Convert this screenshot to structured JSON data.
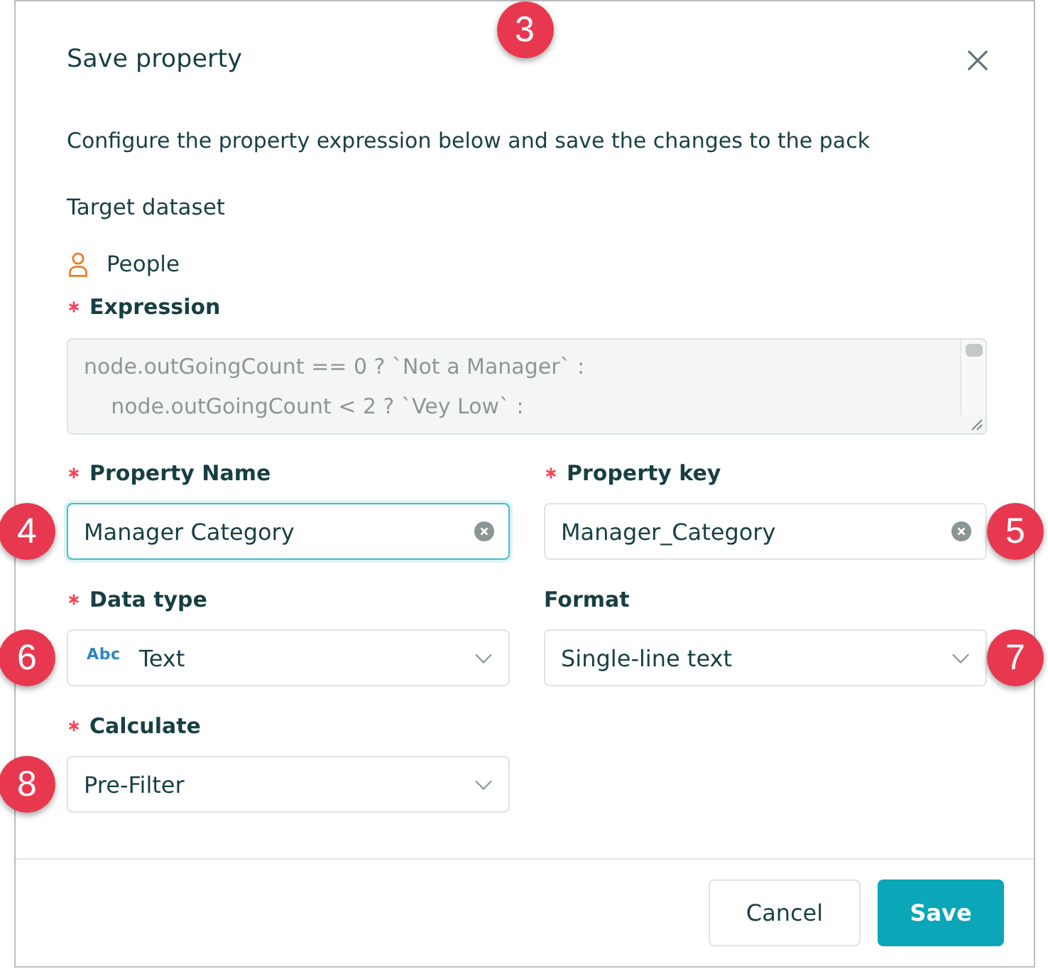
{
  "dialog": {
    "title": "Save property",
    "callout": "3",
    "description": "Configure the property expression below and save the changes to the pack",
    "target_dataset": {
      "label": "Target dataset",
      "value": "People"
    },
    "expression": {
      "label": "Expression",
      "required": true,
      "lines": [
        "node.outGoingCount == 0 ? `Not a Manager` :",
        "    node.outGoingCount < 2 ? `Vey Low` :"
      ]
    },
    "fields": [
      {
        "kind": "text_input",
        "label": "Property Name",
        "required": true,
        "value": "Manager Category",
        "focused": true,
        "callout": "4"
      },
      {
        "kind": "text_input",
        "label": "Property key",
        "required": true,
        "value": "Manager_Category",
        "focused": false,
        "callout": "5"
      },
      {
        "kind": "select",
        "label": "Data type",
        "required": true,
        "badge": "Abc",
        "value": "Text",
        "focused": false,
        "callout": "6"
      },
      {
        "kind": "select",
        "label": "Format",
        "required": false,
        "value": "Single-line text",
        "focused": false,
        "callout": "7"
      },
      {
        "kind": "select",
        "label": "Calculate",
        "required": true,
        "value": "Pre-Filter",
        "focused": false,
        "callout": "8"
      }
    ],
    "buttons": [
      {
        "label": "Cancel",
        "kind": "secondary"
      },
      {
        "label": "Save",
        "kind": "primary"
      }
    ]
  }
}
